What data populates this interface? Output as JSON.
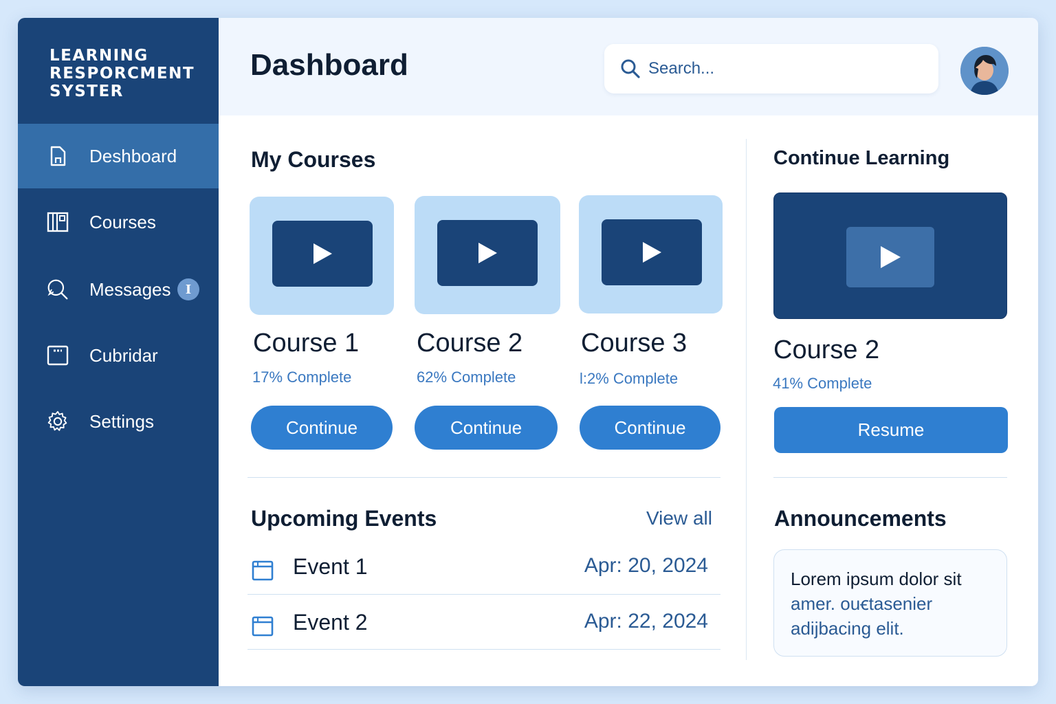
{
  "brand": {
    "line1": "LEARNING",
    "line2": "RESPORCMENT",
    "line3": "SYSTER"
  },
  "sidebar": {
    "items": [
      {
        "label": "Deshboard",
        "icon": "document-icon",
        "active": true
      },
      {
        "label": "Courses",
        "icon": "courses-grid-icon",
        "active": false
      },
      {
        "label": "Messages",
        "icon": "message-search-icon",
        "active": false,
        "badge": "I"
      },
      {
        "label": "Cubridar",
        "icon": "calendar-icon",
        "active": false
      },
      {
        "label": "Settings",
        "icon": "gear-icon",
        "active": false
      }
    ]
  },
  "header": {
    "title": "Dashboard",
    "search_placeholder": "Search..."
  },
  "courses": {
    "title": "My Courses",
    "items": [
      {
        "name": "Course 1",
        "progress": "17% Complete",
        "button": "Continue"
      },
      {
        "name": "Course 2",
        "progress": "62% Complete",
        "button": "Continue"
      },
      {
        "name": "Course 3",
        "progress": "l:2% Complete",
        "button": "Continue"
      }
    ]
  },
  "events": {
    "title": "Upcoming Events",
    "view_all": "View all",
    "items": [
      {
        "name": "Event 1",
        "date": "Apr: 20, 2024"
      },
      {
        "name": "Event 2",
        "date": "Apr: 22, 2024"
      }
    ]
  },
  "continue_learning": {
    "title": "Continue Learning",
    "course": "Course 2",
    "progress": "41% Complete",
    "button": "Resume"
  },
  "announcements": {
    "title": "Announcements",
    "line1": "Lorem ipsum dolor sit",
    "line2": "amer. ouꞓtasenier",
    "line3": "adijbacing elit."
  },
  "colors": {
    "sidebar": "#1a4478",
    "sidebar_active": "#346ea9",
    "accent": "#2f7fd1",
    "thumb_bg": "#bcdcf7",
    "link": "#2b5b94"
  }
}
